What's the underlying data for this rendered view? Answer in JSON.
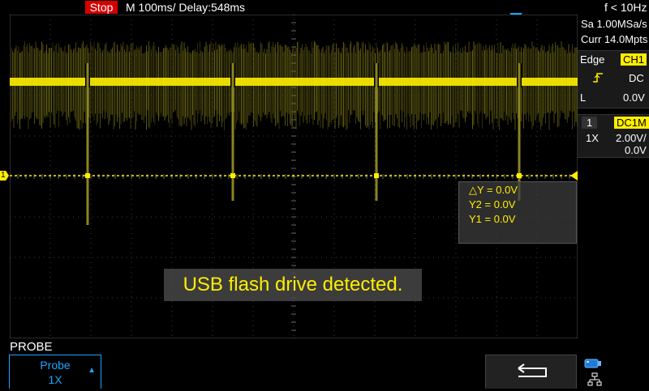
{
  "topbar": {
    "run_state": "Stop",
    "timebase": "M 100ms/  Delay:548ms",
    "frequency": "f < 10Hz"
  },
  "right_panel": {
    "sample_rate": "Sa 1.00MSa/s",
    "memory_depth": "Curr 14.0Mpts",
    "trigger": {
      "type": "Edge",
      "source": "CH1",
      "slope_icon": "rising-edge-icon",
      "coupling": "DC",
      "level_label": "L",
      "level_value": "0.0V"
    },
    "channel": {
      "number": "1",
      "coupling": "DC1M",
      "probe": "1X",
      "scale": "2.00V/",
      "offset": "0.0V"
    }
  },
  "cursor_readout": {
    "delta_y": "△Y = 0.0V",
    "y2": "Y2 = 0.0V",
    "y1": "Y1 = 0.0V"
  },
  "toast": {
    "message": "USB flash drive detected."
  },
  "ground_marker_label": "1",
  "bottom_menu": {
    "title": "PROBE",
    "probe_softkey_label": "Probe",
    "probe_softkey_value": "1X",
    "back_icon": "return-arrow-icon",
    "usb_icon": "usb-storage-icon",
    "network_icon": "network-icon"
  },
  "colors": {
    "channel1": "#ffee00",
    "stop": "#d40000",
    "accent": "#19a6ff"
  }
}
